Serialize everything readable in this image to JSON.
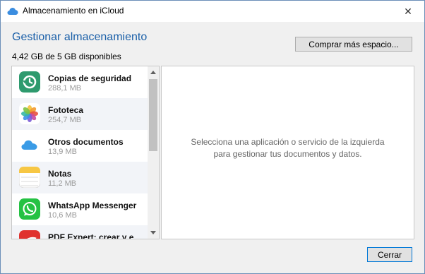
{
  "window": {
    "title": "Almacenamiento en iCloud",
    "close_symbol": "✕"
  },
  "header": {
    "heading": "Gestionar almacenamiento",
    "available": "4,42 GB de 5 GB disponibles",
    "buy_button": "Comprar más espacio..."
  },
  "apps": [
    {
      "name": "Copias de seguridad",
      "size": "288,1 MB",
      "icon": "backup-icon",
      "color": "#2e9a6e"
    },
    {
      "name": "Fototeca",
      "size": "254,7 MB",
      "icon": "photos-icon",
      "color": "#f2a23a"
    },
    {
      "name": "Otros documentos",
      "size": "13,9 MB",
      "icon": "icloud-drive-icon",
      "color": "#3a9be6"
    },
    {
      "name": "Notas",
      "size": "11,2 MB",
      "icon": "notes-icon",
      "color": "#f7c744"
    },
    {
      "name": "WhatsApp Messenger",
      "size": "10,6 MB",
      "icon": "whatsapp-icon",
      "color": "#25c243"
    },
    {
      "name": "PDF Expert: crear y e...",
      "size": "",
      "icon": "pdf-expert-icon",
      "color": "#e0322e"
    }
  ],
  "detail": {
    "message": "Selecciona una aplicación o servicio de la izquierda para gestionar tus documentos y datos."
  },
  "footer": {
    "cancel_button": "Cerrar"
  }
}
